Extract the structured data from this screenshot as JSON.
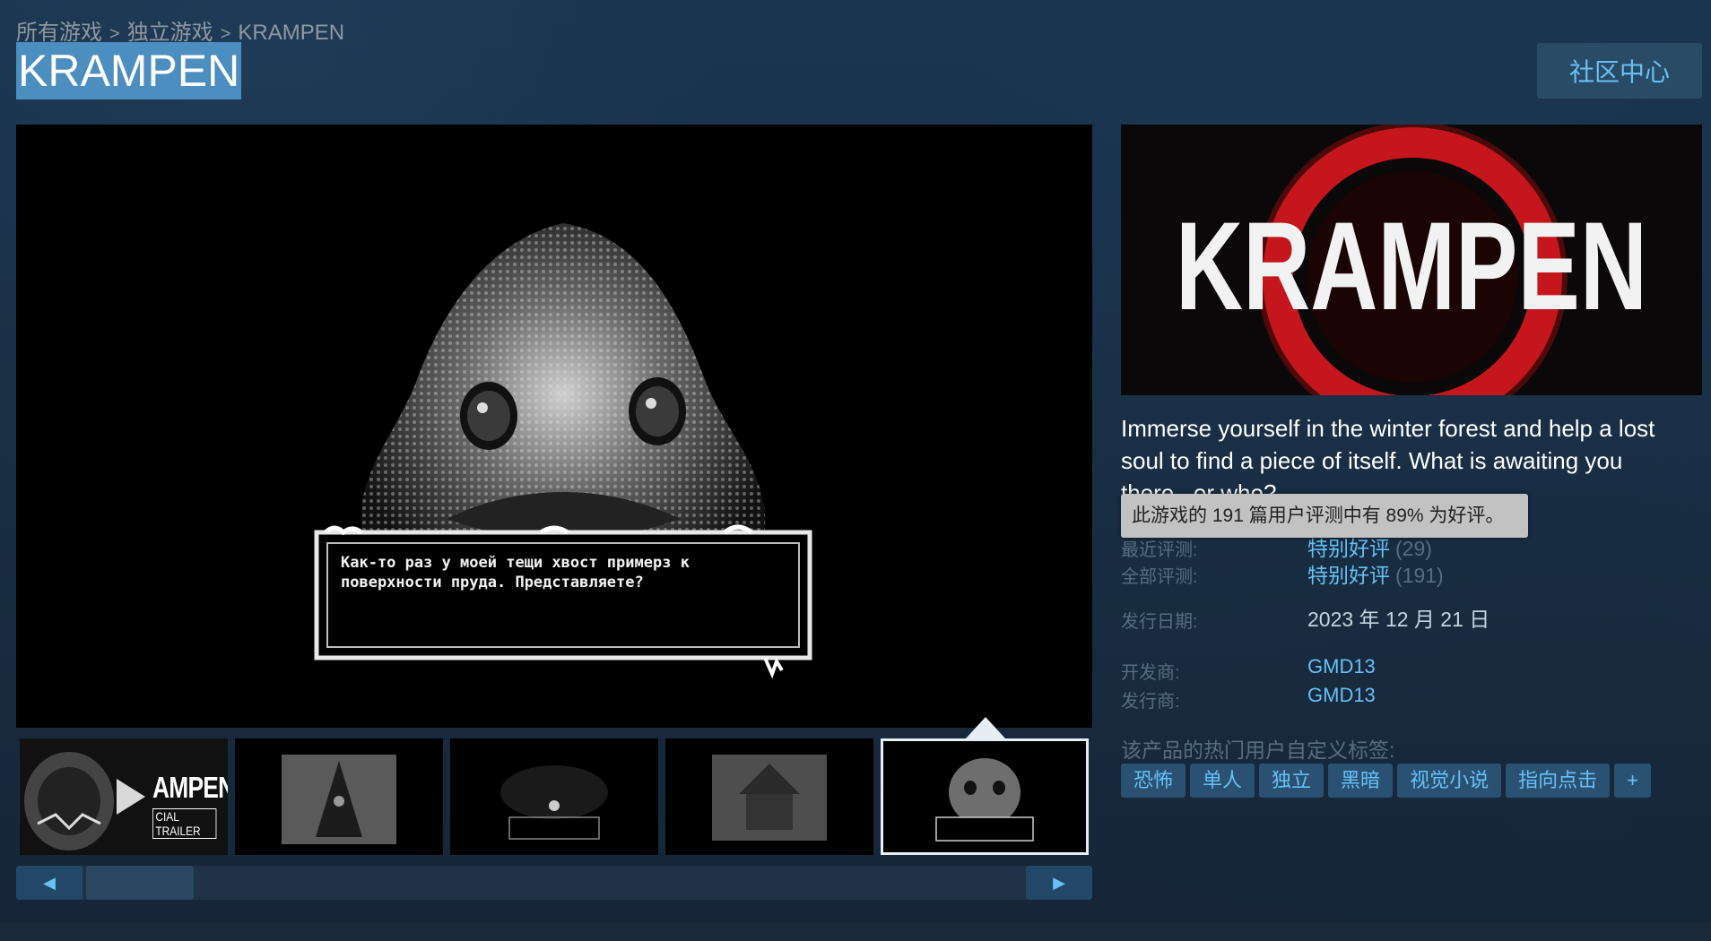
{
  "breadcrumb": {
    "items": [
      "所有游戏",
      "独立游戏",
      "KRAMPEN"
    ],
    "separator": ">"
  },
  "title": "KRAMPEN",
  "community_button": "社区中心",
  "main_media": {
    "dialogue": "Как-то раз у моей тещи хвост примерз к поверхности пруда. Представляете?"
  },
  "thumbnails": [
    {
      "label": "AMPEN",
      "sublabel": "CIAL TRAILER",
      "type": "video"
    },
    {
      "type": "screenshot"
    },
    {
      "type": "screenshot"
    },
    {
      "type": "screenshot"
    },
    {
      "type": "screenshot",
      "selected": true
    }
  ],
  "slider": {
    "prev_icon": "◀",
    "next_icon": "▶"
  },
  "capsule": {
    "logo_text": "KRAMPEN"
  },
  "description": "Immerse yourself in the winter forest and help a lost soul to find a piece of itself. What is awaiting you there...or who?",
  "tooltip": "此游戏的 191 篇用户评测中有 89% 为好评。",
  "reviews": {
    "recent_label": "最近评测:",
    "recent_value": "特别好评",
    "recent_count": "(29)",
    "all_label": "全部评测:",
    "all_value": "特别好评",
    "all_count": "(191)"
  },
  "release": {
    "label": "发行日期:",
    "value": "2023 年 12 月 21 日"
  },
  "developer": {
    "label": "开发商:",
    "value": "GMD13"
  },
  "publisher": {
    "label": "发行商:",
    "value": "GMD13"
  },
  "tags_header": "该产品的热门用户自定义标签:",
  "tags": [
    "恐怖",
    "单人",
    "独立",
    "黑暗",
    "视觉小说",
    "指向点击",
    "+"
  ],
  "colors": {
    "accent": "#66c0f4",
    "title_bg": "#4c8ebf",
    "tag_bg": "#2a5072"
  }
}
